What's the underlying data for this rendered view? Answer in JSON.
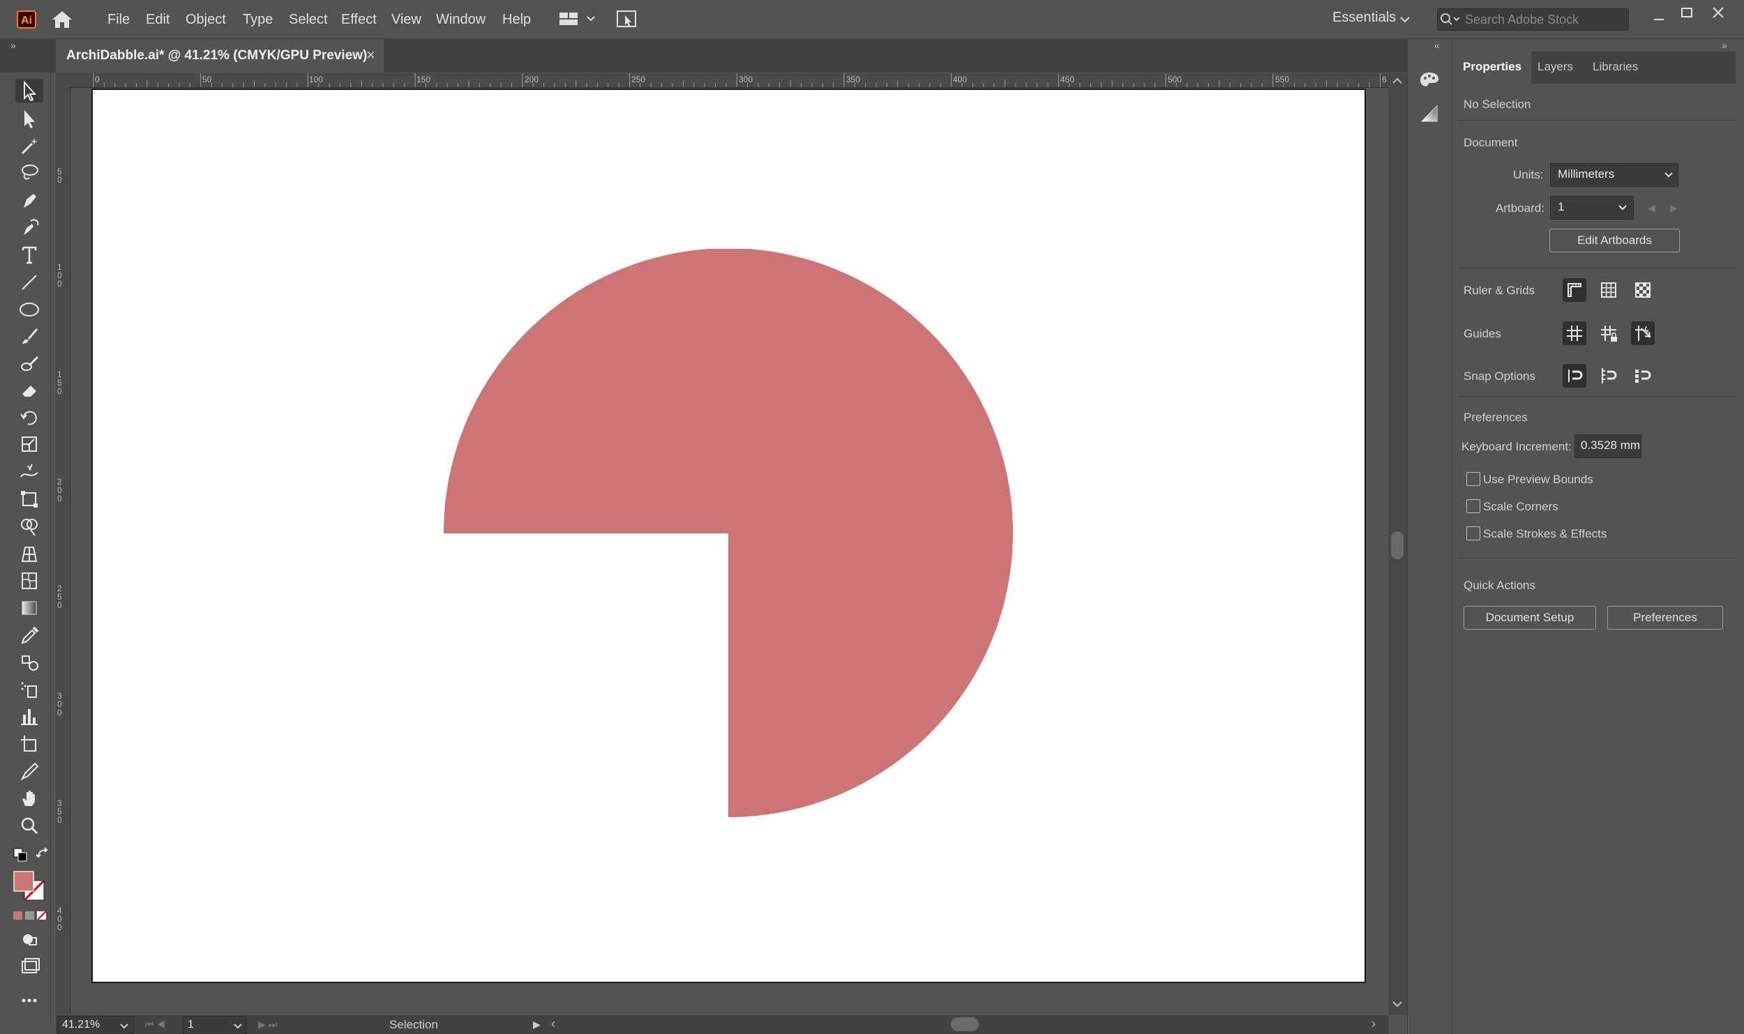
{
  "app": {
    "logo": "Ai"
  },
  "menu": [
    "File",
    "Edit",
    "Object",
    "Type",
    "Select",
    "Effect",
    "View",
    "Window",
    "Help"
  ],
  "workspace": "Essentials",
  "search": {
    "placeholder": "Search Adobe Stock"
  },
  "document": {
    "tab_title": "ArchiDabble.ai* @ 41.21% (CMYK/GPU Preview)",
    "close": "×"
  },
  "ruler": {
    "h_ticks": [
      "0",
      "50",
      "100",
      "150",
      "200",
      "250",
      "300",
      "350",
      "400",
      "450",
      "500",
      "550",
      "6"
    ],
    "v_ticks": [
      "5 0",
      "1 0 0",
      "1 5 0",
      "2 0 0",
      "2 5 0",
      "3 0 0",
      "3 5 0",
      "4 0 0"
    ]
  },
  "artwork": {
    "shape": "three-quarter circle",
    "fill": "#cd7475"
  },
  "status": {
    "zoom": "41.21%",
    "artboard": "1",
    "tool": "Selection"
  },
  "panel": {
    "tabs": [
      "Properties",
      "Layers",
      "Libraries"
    ],
    "selection": "No Selection",
    "document_heading": "Document",
    "units_label": "Units:",
    "units_value": "Millimeters",
    "artboard_label": "Artboard:",
    "artboard_value": "1",
    "edit_artboards": "Edit Artboards",
    "ruler_grids": "Ruler & Grids",
    "guides": "Guides",
    "snap_options": "Snap Options",
    "preferences_heading": "Preferences",
    "keyboard_increment_label": "Keyboard Increment:",
    "keyboard_increment_value": "0.3528 mm",
    "checkboxes": [
      "Use Preview Bounds",
      "Scale Corners",
      "Scale Strokes & Effects"
    ],
    "quick_actions": "Quick Actions",
    "document_setup": "Document Setup",
    "preferences_button": "Preferences"
  },
  "colors": {
    "fill_swatch": "#cd7475",
    "accent_logo": "#ff7c00"
  }
}
